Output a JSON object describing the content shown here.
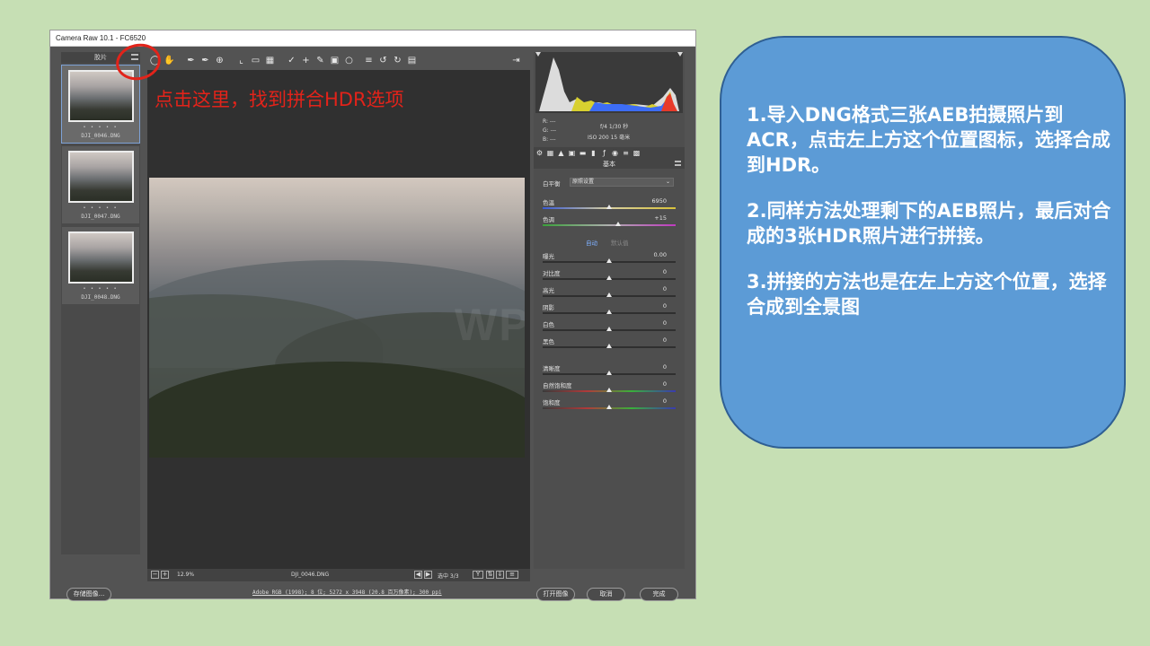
{
  "window": {
    "title": "Camera Raw 10.1 - FC6520"
  },
  "filmstrip": {
    "header": "胶片",
    "thumbnails": [
      {
        "name": "DJI_0046.DNG",
        "stars": "• • • • •",
        "selected": true
      },
      {
        "name": "DJI_0047.DNG",
        "stars": "• • • • •",
        "selected": false
      },
      {
        "name": "DJI_0048.DNG",
        "stars": "• • • • •",
        "selected": false
      }
    ]
  },
  "toolbar": {
    "tools": [
      "zoom-icon",
      "hand-icon",
      "white-balance-icon",
      "color-sampler-icon",
      "target-adjust-icon",
      "crop-icon",
      "straighten-icon",
      "transform-icon",
      "spot-removal-icon",
      "red-eye-icon",
      "brush-icon",
      "graduated-filter-icon",
      "radial-filter-icon",
      "preferences-icon",
      "rotate-left-icon",
      "rotate-right-icon",
      "trash-icon"
    ]
  },
  "annotation": {
    "text": "点击这里，找到拼合HDR选项",
    "color": "#e2231a"
  },
  "preview": {
    "watermark": "WPS"
  },
  "statusbar": {
    "zoom": "12.9%",
    "filename": "DJI_0046.DNG",
    "selection": "选中 3/3"
  },
  "panel": {
    "camera_info": {
      "rgb_labels": [
        "R: ---",
        "G: ---",
        "B: ---"
      ],
      "aperture_shutter": "f/4  1/30 秒",
      "iso_focal": "ISO 200  15 毫米"
    },
    "title": "基本",
    "white_balance": {
      "label": "白平衡",
      "value": "原照设置"
    },
    "auto_label": "自动",
    "default_label": "默认值",
    "sliders": [
      {
        "label": "色温",
        "value": "6950",
        "level": 0.5
      },
      {
        "label": "色调",
        "value": "+15",
        "level": 0.57
      },
      {
        "label": "曝光",
        "value": "0.00",
        "level": 0.5
      },
      {
        "label": "对比度",
        "value": "0",
        "level": 0.5
      },
      {
        "label": "高光",
        "value": "0",
        "level": 0.5
      },
      {
        "label": "阴影",
        "value": "0",
        "level": 0.5
      },
      {
        "label": "白色",
        "value": "0",
        "level": 0.5
      },
      {
        "label": "黑色",
        "value": "0",
        "level": 0.5
      },
      {
        "label": "清晰度",
        "value": "0",
        "level": 0.5
      },
      {
        "label": "自然饱和度",
        "value": "0",
        "level": 0.5
      },
      {
        "label": "饱和度",
        "value": "0",
        "level": 0.5
      }
    ]
  },
  "bottom": {
    "save_label": "存储图像...",
    "workflow": "Adobe RGB (1998); 8 位; 5272 x 3948 (20.8 百万像素); 300 ppi",
    "open_label": "打开图像",
    "cancel_label": "取消",
    "done_label": "完成"
  },
  "callout": {
    "paragraphs": [
      "1.导入DNG格式三张AEB拍摄照片到ACR，点击左上方这个位置图标，选择合成到HDR。",
      "2.同样方法处理剩下的AEB照片，最后对合成的3张HDR照片进行拼接。",
      "3.拼接的方法也是在左上方这个位置，选择合成到全景图"
    ]
  }
}
